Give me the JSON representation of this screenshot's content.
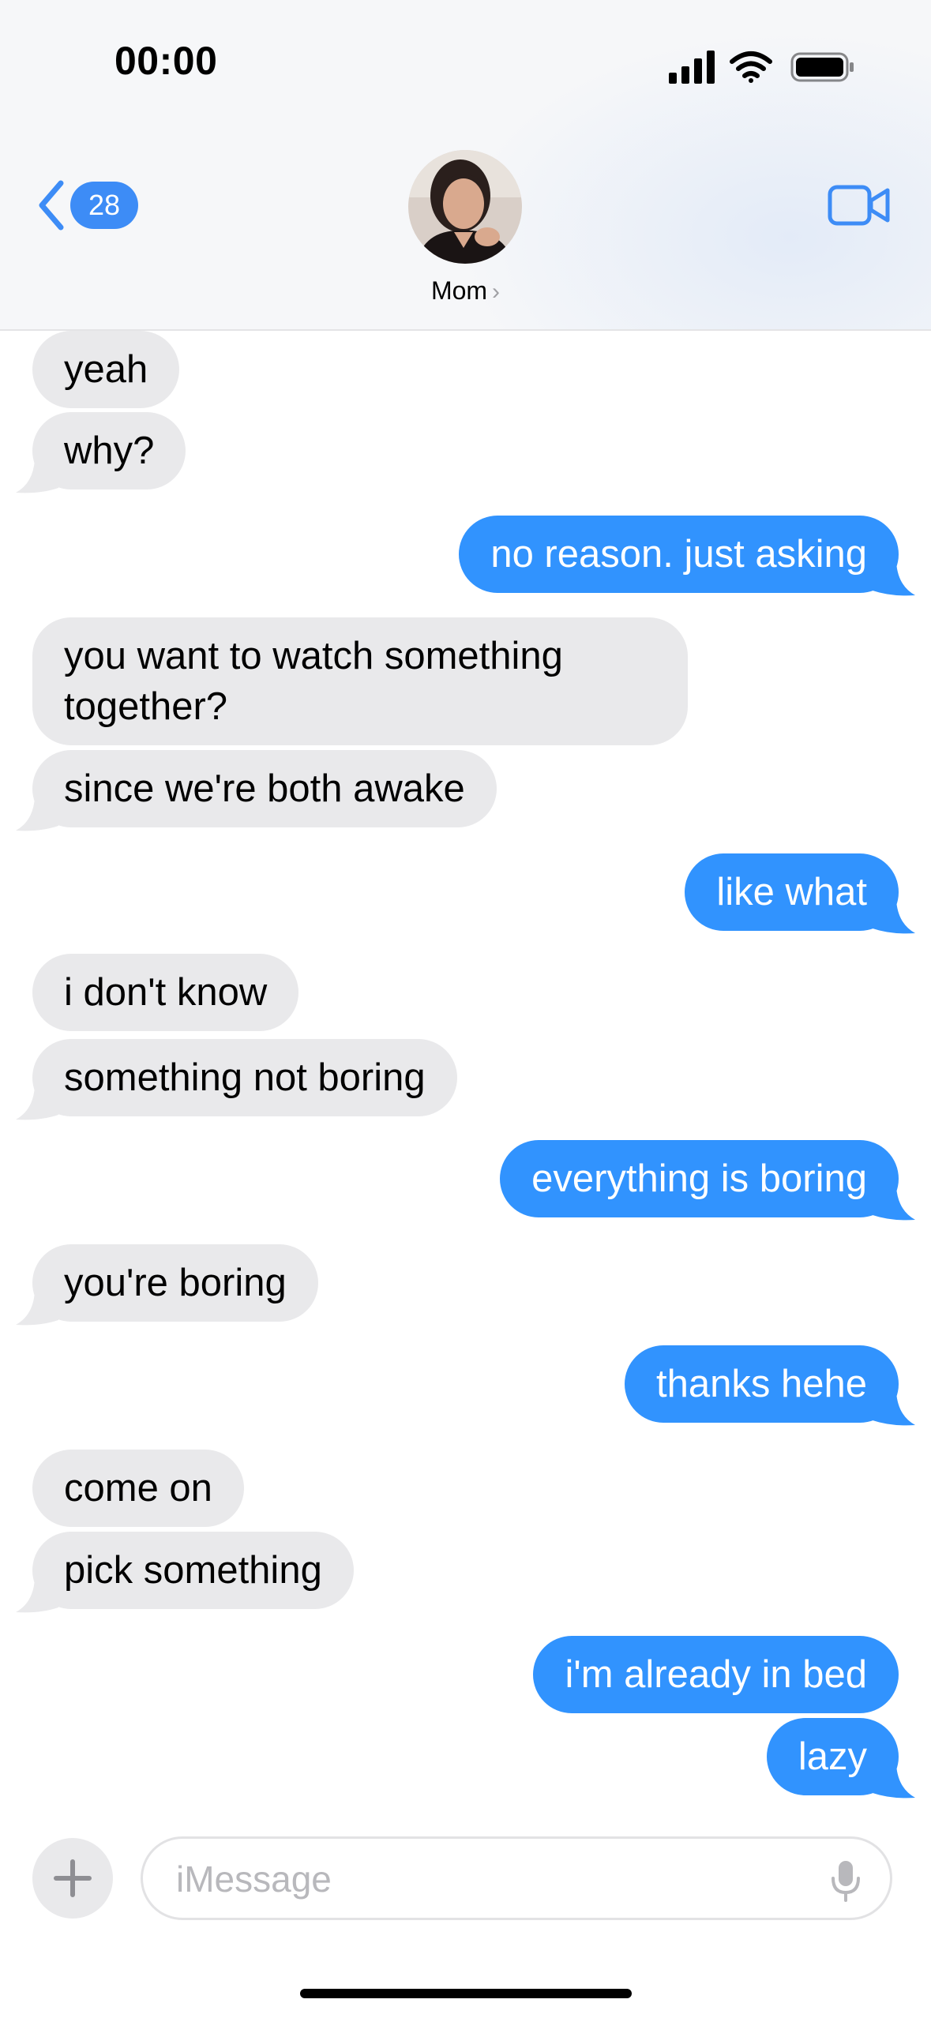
{
  "status_bar": {
    "time": "00:00",
    "icons": [
      "cellular-signal-icon",
      "wifi-icon",
      "battery-icon"
    ]
  },
  "header": {
    "back_count": "28",
    "contact_name": "Mom",
    "icons": [
      "back-chevron-icon",
      "video-camera-icon",
      "contact-chevron-icon"
    ]
  },
  "messages": [
    {
      "from": "them",
      "text": "yeah"
    },
    {
      "from": "them",
      "text": "why?"
    },
    {
      "from": "me",
      "text": "no reason. just asking"
    },
    {
      "from": "them",
      "text": "you want to watch something together?"
    },
    {
      "from": "them",
      "text": "since we're both awake"
    },
    {
      "from": "me",
      "text": "like what"
    },
    {
      "from": "them",
      "text": "i don't know"
    },
    {
      "from": "them",
      "text": "something not boring"
    },
    {
      "from": "me",
      "text": "everything is boring"
    },
    {
      "from": "them",
      "text": "you're boring"
    },
    {
      "from": "me",
      "text": "thanks hehe"
    },
    {
      "from": "them",
      "text": "come on"
    },
    {
      "from": "them",
      "text": "pick something"
    },
    {
      "from": "me",
      "text": "i'm already in bed"
    },
    {
      "from": "me",
      "text": "lazy"
    }
  ],
  "input": {
    "placeholder": "iMessage",
    "icons": [
      "plus-icon",
      "microphone-icon"
    ]
  },
  "colors": {
    "outgoing_bubble": "#3193fe",
    "incoming_bubble": "#e9e9eb",
    "accent": "#3d8cf6"
  }
}
